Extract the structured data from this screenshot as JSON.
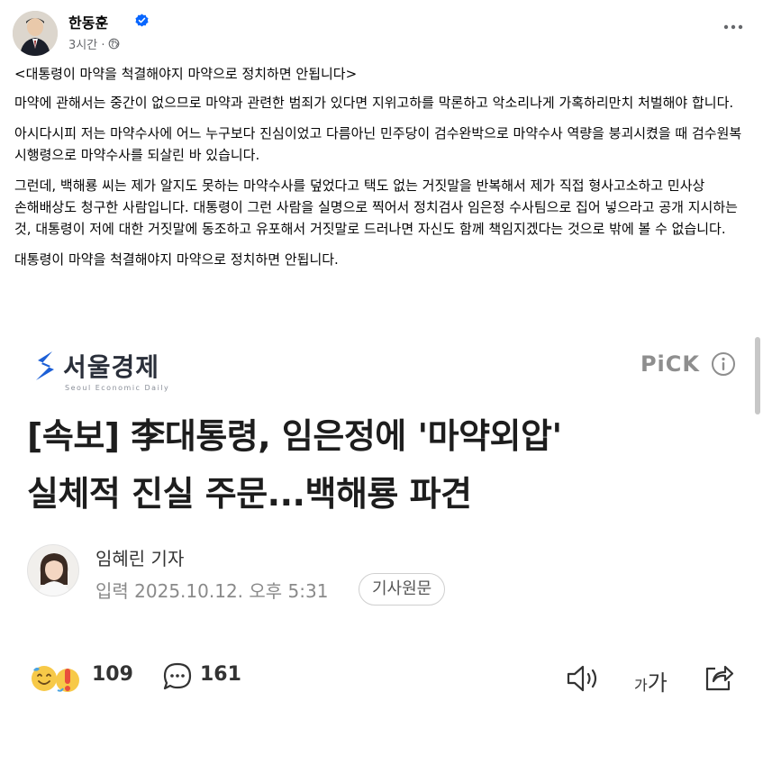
{
  "post": {
    "author": "한동훈",
    "time": "3시간 ·",
    "paragraphs": [
      "<대통령이 마약을 척결해야지 마약으로 정치하면 안됩니다>",
      "마약에 관해서는 중간이 없으므로 마약과 관련한 범죄가 있다면 지위고하를 막론하고 악소리나게 가혹하리만치 처벌해야 합니다.",
      "아시다시피 저는 마약수사에 어느 누구보다 진심이었고 다름아닌 민주당이 검수완박으로 마약수사 역량을 붕괴시켰을 때 검수원복 시행령으로 마약수사를 되살린 바 있습니다.",
      "그런데, 백해룡 씨는 제가 알지도 못하는 마약수사를 덮었다고 택도 없는 거짓말을 반복해서 제가 직접 형사고소하고 민사상 손해배상도 청구한 사람입니다. 대통령이 그런 사람을 실명으로 찍어서 정치검사 임은정 수사팀으로 집어 넣으라고 공개 지시하는 것, 대통령이 저에 대한 거짓말에 동조하고 유포해서 거짓말로 드러나면 자신도 함께 책임지겠다는 것으로 밖에 볼 수 없습니다.",
      "대통령이 마약을 척결해야지 마약으로 정치하면 안됩니다."
    ]
  },
  "article": {
    "outlet_name": "서울경제",
    "outlet_sub": "Seoul Economic Daily",
    "pick_label": "PiCK",
    "headline": "[속보] 李대통령, 임은정에 '마약외압'\n실체적 진실 주문...백해룡 파견",
    "reporter": "임혜린 기자",
    "published": "입력 2025.10.12. 오후 5:31",
    "source_button": "기사원문",
    "reactions_count": "109",
    "comments_count": "161",
    "font_size_small": "가",
    "font_size_large": "가"
  },
  "icons": {
    "verified": "verified-badge-icon",
    "audience": "globe-icon",
    "more": "more-options-icon",
    "info": "info-icon",
    "comment": "comment-icon",
    "tts": "speaker-icon",
    "share": "share-icon"
  },
  "colors": {
    "facebook_blue": "#0866ff",
    "meta_grey": "#65676b",
    "pick_grey": "#8e8e8e",
    "logo_blue": "#1c5fd6"
  }
}
